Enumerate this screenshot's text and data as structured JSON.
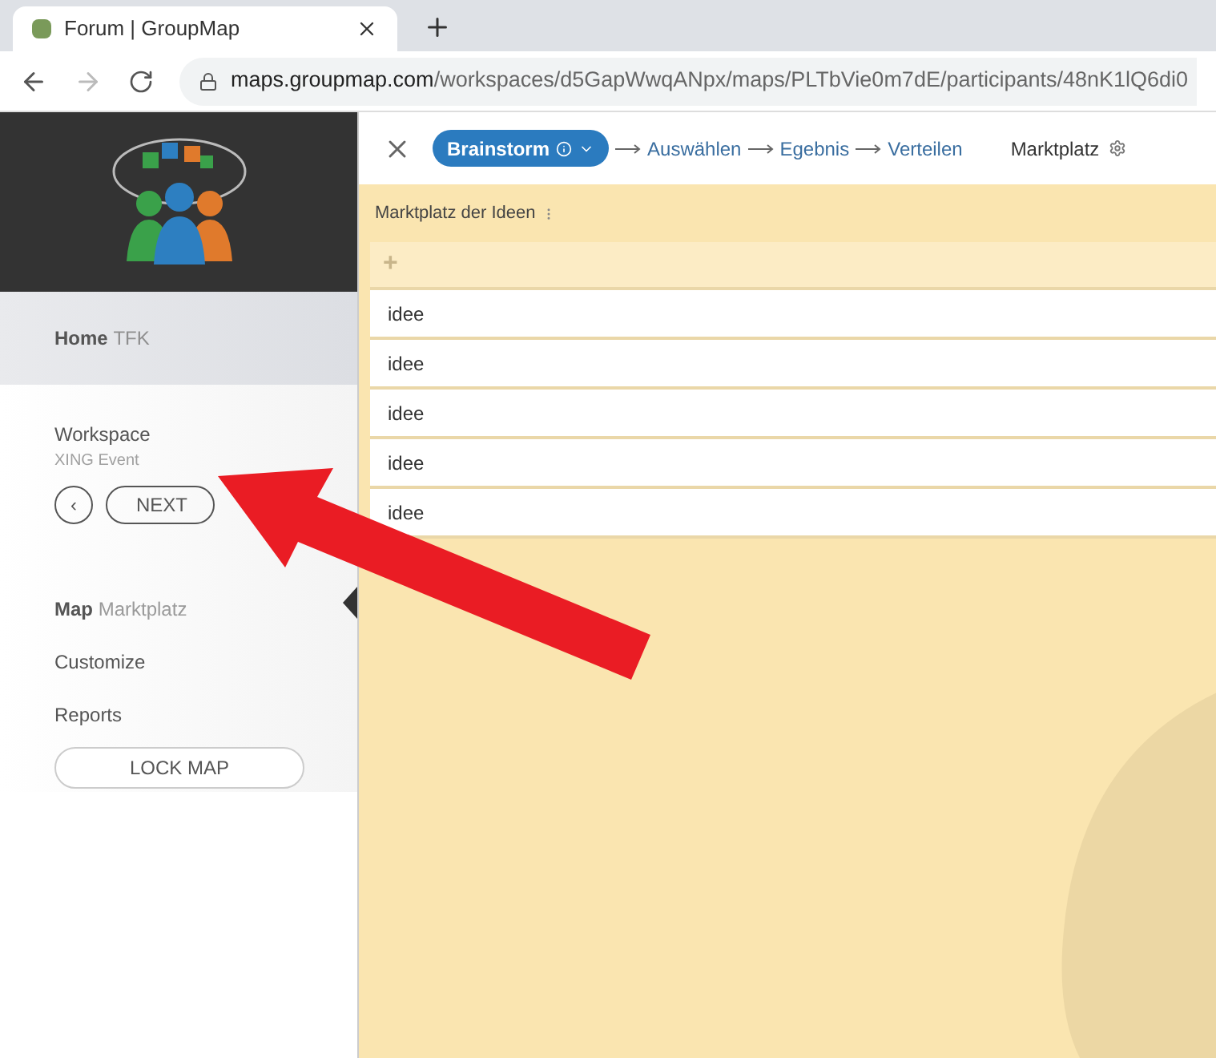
{
  "browser": {
    "tab_title": "Forum | GroupMap",
    "url_host": "maps.groupmap.com",
    "url_path": "/workspaces/d5GapWwqANpx/maps/PLTbVie0m7dE/participants/48nK1lQ6di0"
  },
  "sidebar": {
    "home": {
      "label": "Home",
      "sub": "TFK"
    },
    "workspace": {
      "label": "Workspace",
      "sub": "XING Event"
    },
    "prev": "‹",
    "next": "NEXT",
    "nav": [
      {
        "label": "Map",
        "sub": "Marktplatz",
        "selected": true
      },
      {
        "label": "Customize",
        "selected": false
      },
      {
        "label": "Reports",
        "selected": false
      }
    ],
    "lock": "LOCK MAP"
  },
  "steps": [
    {
      "label": "Brainstorm",
      "selected": true
    },
    {
      "label": "Auswählen",
      "selected": false
    },
    {
      "label": "Egebnis",
      "selected": false
    },
    {
      "label": "Verteilen",
      "selected": false
    }
  ],
  "map_name": "Marktplatz",
  "board": {
    "title": "Marktplatz der Ideen",
    "add": "+",
    "items": [
      "idee",
      "idee",
      "idee",
      "idee",
      "idee"
    ]
  }
}
